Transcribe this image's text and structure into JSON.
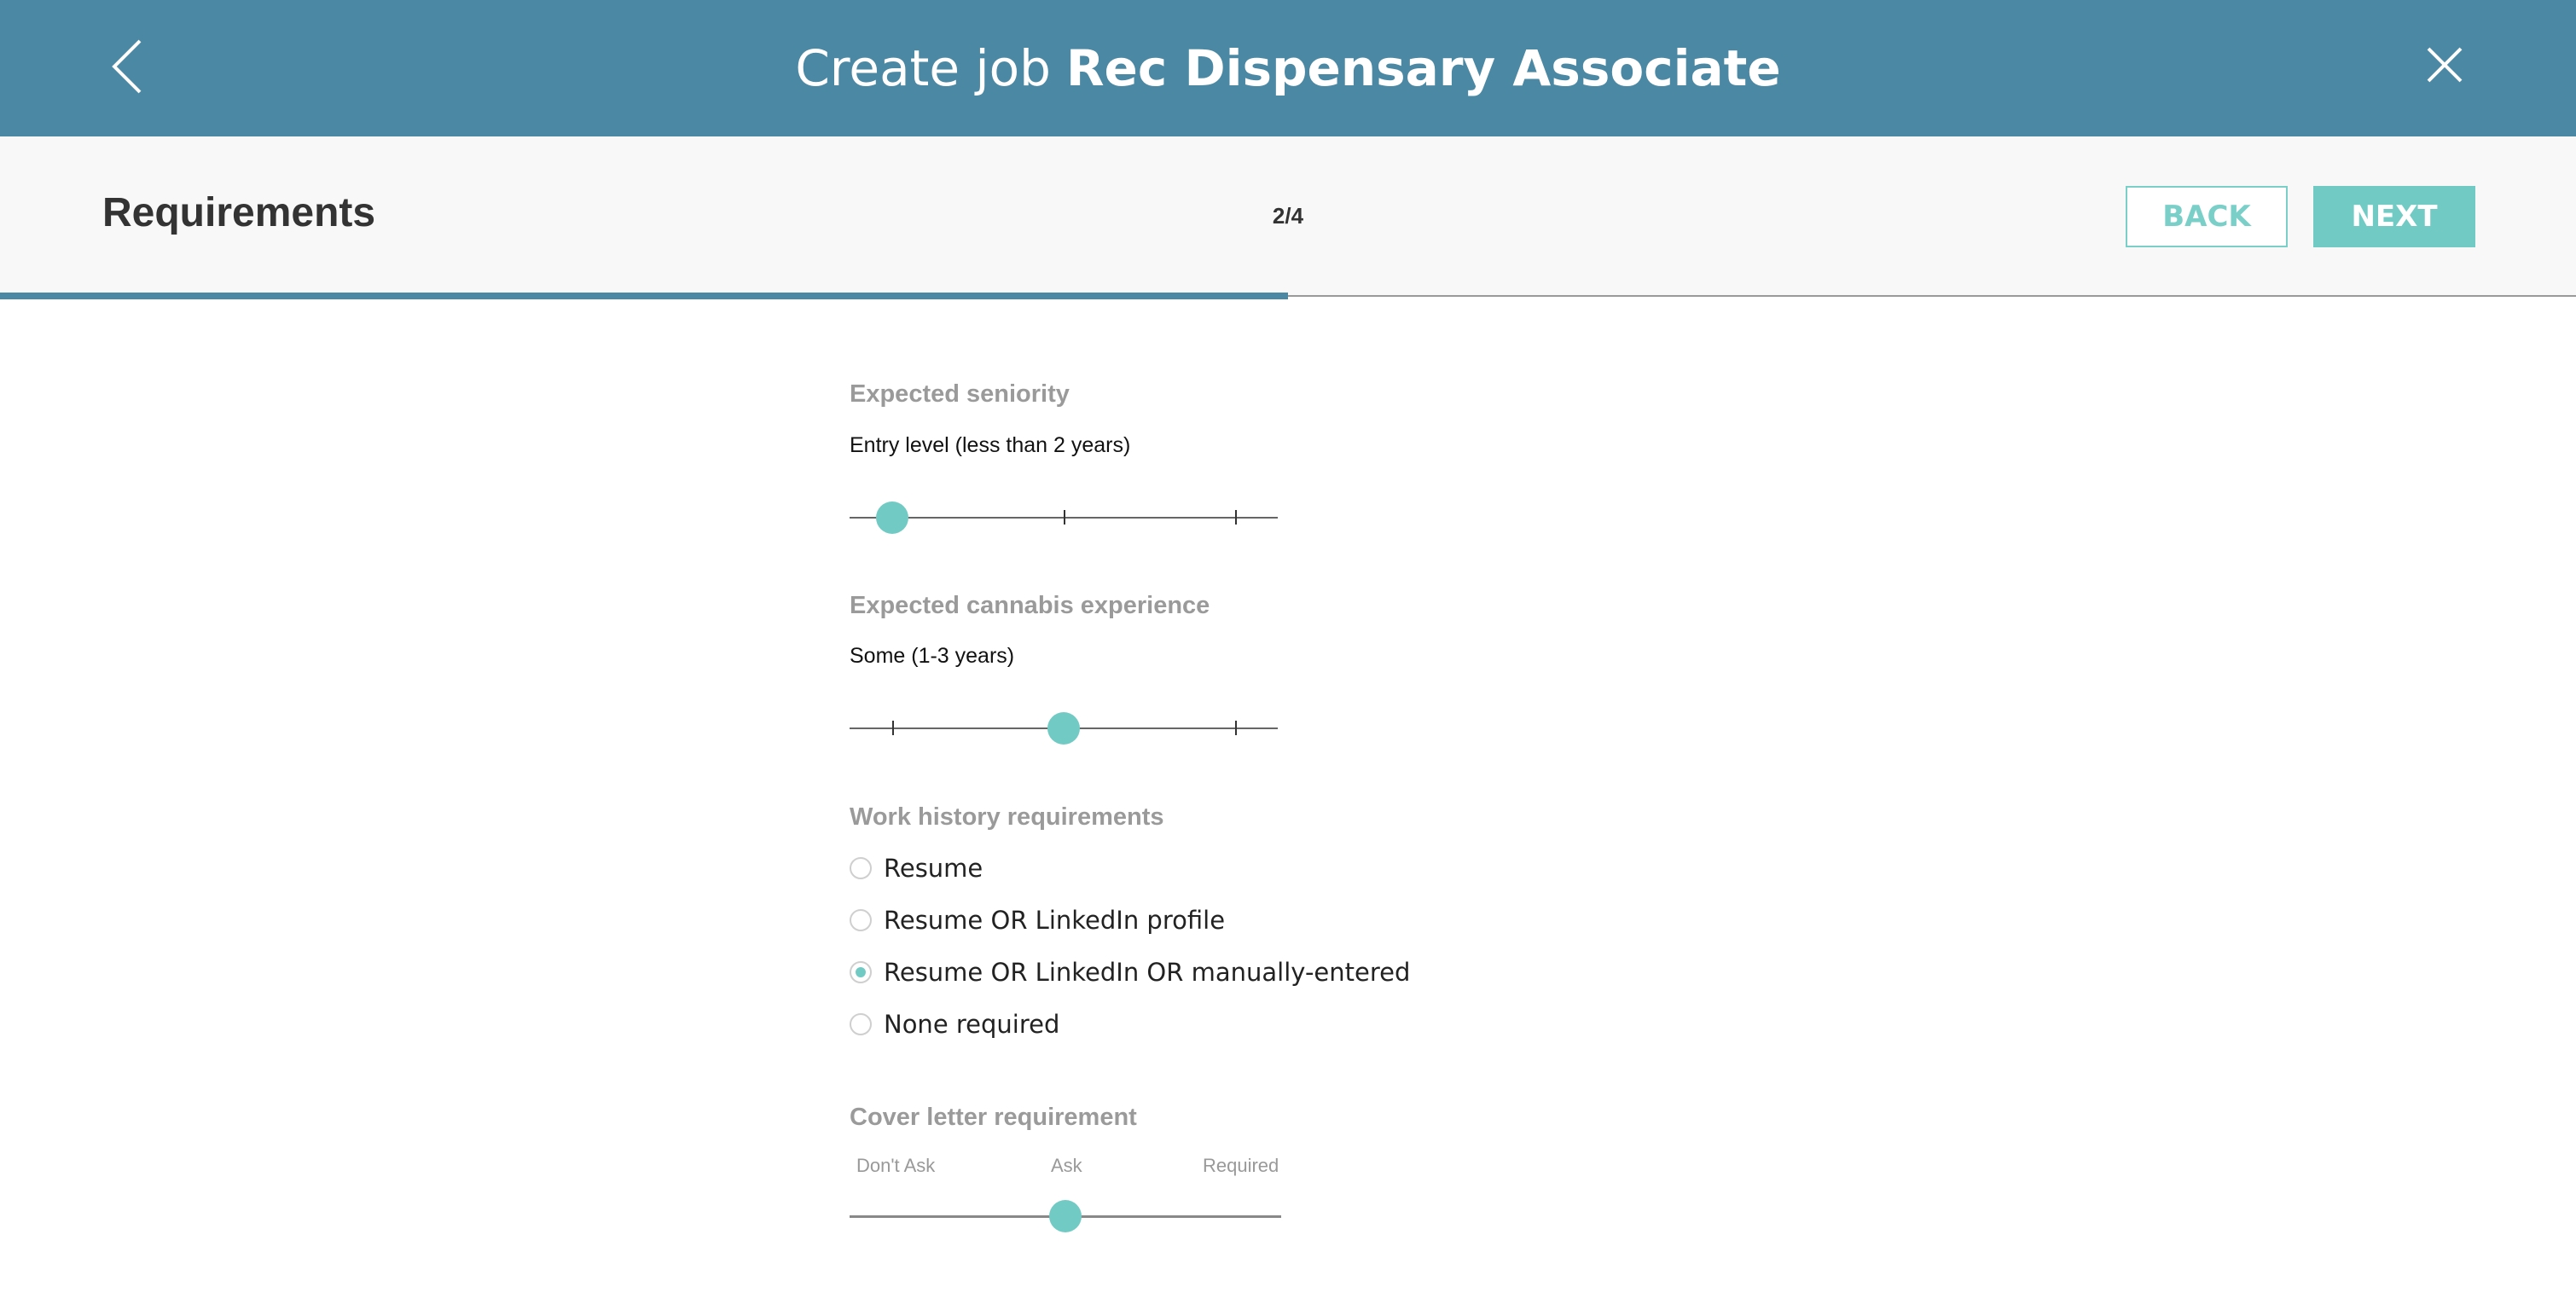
{
  "header": {
    "title_lead": "Create job",
    "title_job": "Rec Dispensary Associate",
    "back_icon": "chevron-left-icon",
    "close_icon": "close-icon",
    "background": "#4b88a3"
  },
  "subheader": {
    "section_title": "Requirements",
    "step": "2/4",
    "step_progress": 0.5,
    "back_label": "BACK",
    "next_label": "NEXT",
    "accent": "#71cbc4"
  },
  "seniority": {
    "label": "Expected seniority",
    "value": "Entry level (less than 2 years)",
    "positions": 3,
    "selected_index": 0
  },
  "cannabis": {
    "label": "Expected cannabis experience",
    "value": "Some (1-3 years)",
    "positions": 3,
    "selected_index": 1
  },
  "work_history": {
    "label": "Work history requirements",
    "options": [
      "Resume",
      "Resume OR LinkedIn profile",
      "Resume OR LinkedIn OR manually-entered",
      "None required"
    ],
    "selected_index": 2
  },
  "cover_letter": {
    "label": "Cover letter requirement",
    "options": [
      "Don't Ask",
      "Ask",
      "Required"
    ],
    "selected_index": 1
  }
}
